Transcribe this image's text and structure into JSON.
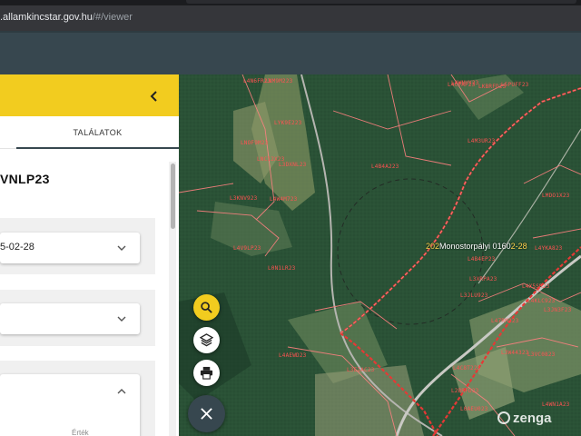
{
  "browser": {
    "url_host": ".allamkincstar.gov.hu",
    "url_path": "/#/viewer"
  },
  "panel": {
    "tabs": [
      {
        "label": "TALÁLATOK"
      }
    ],
    "parcel_id": "VNLP23",
    "date_value": "5-02-28",
    "value_label": "Érték"
  },
  "map": {
    "place_label": {
      "prefix": "202",
      "name": "Monostorpályi 0160",
      "suffix": "2-28"
    },
    "parcel_labels": [
      "L4N6FR23",
      "LNM9M223",
      "LYK9E223",
      "LNOF9M23",
      "LNC12X23",
      "L3DXNL23",
      "L4B4A223",
      "L3KNV923",
      "L4W4M723",
      "L4M3UR23",
      "L4WNUY23",
      "L5PUFF23",
      "L4V9LP23",
      "L0N1LR23",
      "L4B4EP23",
      "L4CTAF23",
      "L3XRPA23",
      "L4X5SR23",
      "L4AEWD23",
      "L3EIAC23",
      "L3JLU923",
      "L47RM223",
      "L3W44323",
      "L3VC0823",
      "L3JN3F23",
      "L4KLC923",
      "L4YKA823",
      "L4C8T223",
      "L2BRFD23",
      "L0AEU023",
      "L4WN1A23",
      "LMDO1X23",
      "LKBRFD23"
    ],
    "colors": {
      "parcel_line": "#ff6e6e",
      "boundary": "#e53935",
      "panel_accent": "#f2cc1f",
      "appbar": "#37474f"
    }
  },
  "controls": {
    "search": "search-icon",
    "layers": "layers-icon",
    "print": "print-icon",
    "close": "close-icon"
  },
  "watermark": "zenga"
}
